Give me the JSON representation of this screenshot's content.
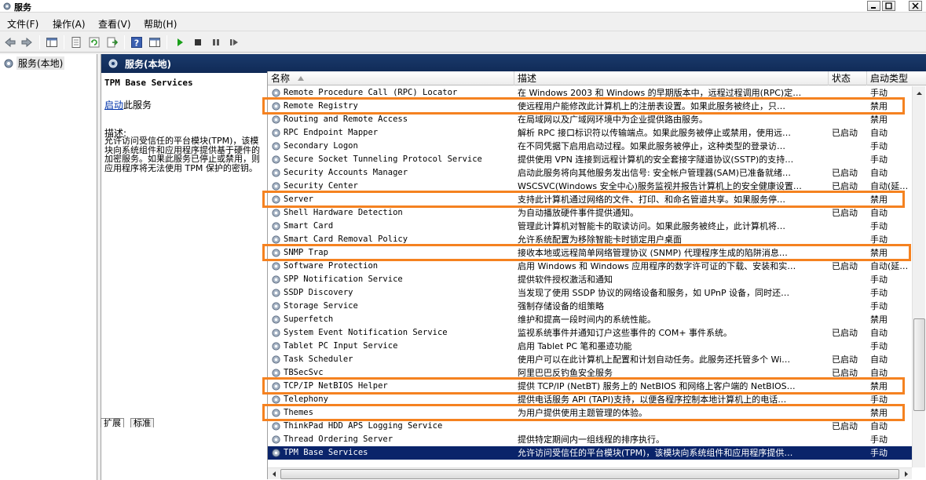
{
  "window": {
    "title": "服务"
  },
  "menu": [
    "文件(F)",
    "操作(A)",
    "查看(V)",
    "帮助(H)"
  ],
  "toolbar": {
    "icons": [
      "back-icon",
      "forward-icon",
      "console-tree-icon",
      "properties-icon",
      "refresh-icon",
      "export-icon",
      "help-icon",
      "show-hide-icon",
      "start-icon",
      "stop-icon",
      "pause-icon",
      "restart-icon"
    ]
  },
  "tree": {
    "root_label": "服务(本地)"
  },
  "content": {
    "header_title": "服务(本地)"
  },
  "detail": {
    "service_name": "TPM Base Services",
    "start_link": "启动",
    "start_suffix": "此服务",
    "desc_label": "描述:",
    "desc_text": "允许访问受信任的平台模块(TPM)，该模块向系统组件和应用程序提供基于硬件的加密服务。如果此服务已停止或禁用，则应用程序将无法使用 TPM 保护的密钥。"
  },
  "columns": {
    "name": "名称",
    "desc": "描述",
    "status": "状态",
    "startup": "启动类型"
  },
  "services": [
    {
      "name": "Remote Procedure Call (RPC) Locator",
      "desc": "在 Windows 2003 和 Windows 的早期版本中，远程过程调用(RPC)定…",
      "status": "",
      "startup": "手动"
    },
    {
      "name": "Remote Registry",
      "desc": "使远程用户能修改此计算机上的注册表设置。如果此服务被终止，只…",
      "status": "",
      "startup": "禁用"
    },
    {
      "name": "Routing and Remote Access",
      "desc": "在局域网以及广域网环境中为企业提供路由服务。",
      "status": "",
      "startup": "禁用"
    },
    {
      "name": "RPC Endpoint Mapper",
      "desc": "解析 RPC 接口标识符以传输端点。如果此服务被停止或禁用，使用远…",
      "status": "已启动",
      "startup": "自动"
    },
    {
      "name": "Secondary Logon",
      "desc": "在不同凭据下启用启动过程。如果此服务被停止，这种类型的登录访…",
      "status": "",
      "startup": "手动"
    },
    {
      "name": "Secure Socket Tunneling Protocol Service",
      "desc": "提供使用 VPN 连接到远程计算机的安全套接字隧道协议(SSTP)的支持…",
      "status": "",
      "startup": "手动"
    },
    {
      "name": "Security Accounts Manager",
      "desc": "启动此服务将向其他服务发出信号: 安全帐户管理器(SAM)已准备就绪…",
      "status": "已启动",
      "startup": "自动"
    },
    {
      "name": "Security Center",
      "desc": "WSCSVC(Windows 安全中心)服务监视并报告计算机上的安全健康设置…",
      "status": "已启动",
      "startup": "自动(延…"
    },
    {
      "name": "Server",
      "desc": "支持此计算机通过网络的文件、打印、和命名管道共享。如果服务停…",
      "status": "",
      "startup": "禁用"
    },
    {
      "name": "Shell Hardware Detection",
      "desc": "为自动播放硬件事件提供通知。",
      "status": "已启动",
      "startup": "自动"
    },
    {
      "name": "Smart Card",
      "desc": "管理此计算机对智能卡的取读访问。如果此服务被终止，此计算机将…",
      "status": "",
      "startup": "手动"
    },
    {
      "name": "Smart Card Removal Policy",
      "desc": "允许系统配置为移除智能卡时锁定用户桌面",
      "status": "",
      "startup": "手动"
    },
    {
      "name": "SNMP Trap",
      "desc": "接收本地或远程简单网络管理协议 (SNMP) 代理程序生成的陷阱消息…",
      "status": "",
      "startup": "禁用"
    },
    {
      "name": "Software Protection",
      "desc": "启用 Windows 和 Windows 应用程序的数字许可证的下载、安装和实…",
      "status": "已启动",
      "startup": "自动(延…"
    },
    {
      "name": "SPP Notification Service",
      "desc": "提供软件授权激活和通知",
      "status": "",
      "startup": "手动"
    },
    {
      "name": "SSDP Discovery",
      "desc": "当发现了使用 SSDP 协议的网络设备和服务，如 UPnP 设备，同时还…",
      "status": "",
      "startup": "手动"
    },
    {
      "name": "Storage Service",
      "desc": "强制存储设备的组策略",
      "status": "",
      "startup": "手动"
    },
    {
      "name": "Superfetch",
      "desc": "维护和提高一段时间内的系统性能。",
      "status": "",
      "startup": "禁用"
    },
    {
      "name": "System Event Notification Service",
      "desc": "监视系统事件并通知订户这些事件的 COM+ 事件系统。",
      "status": "已启动",
      "startup": "自动"
    },
    {
      "name": "Tablet PC Input Service",
      "desc": "启用 Tablet PC 笔和墨迹功能",
      "status": "",
      "startup": "手动"
    },
    {
      "name": "Task Scheduler",
      "desc": "使用户可以在此计算机上配置和计划自动任务。此服务还托管多个 Wi…",
      "status": "已启动",
      "startup": "自动"
    },
    {
      "name": "TBSecSvc",
      "desc": "阿里巴巴反钓鱼安全服务",
      "status": "已启动",
      "startup": "自动"
    },
    {
      "name": "TCP/IP NetBIOS Helper",
      "desc": "提供 TCP/IP (NetBT) 服务上的 NetBIOS 和网络上客户端的 NetBIOS…",
      "status": "",
      "startup": "禁用"
    },
    {
      "name": "Telephony",
      "desc": "提供电话服务 API (TAPI)支持，以便各程序控制本地计算机上的电话…",
      "status": "",
      "startup": "手动"
    },
    {
      "name": "Themes",
      "desc": "为用户提供使用主题管理的体验。",
      "status": "",
      "startup": "禁用"
    },
    {
      "name": "ThinkPad HDD APS Logging Service",
      "desc": "",
      "status": "已启动",
      "startup": "自动"
    },
    {
      "name": "Thread Ordering Server",
      "desc": "提供特定期间内一组线程的排序执行。",
      "status": "",
      "startup": "手动"
    },
    {
      "name": "TPM Base Services",
      "desc": "允许访问受信任的平台模块(TPM)，该模块向系统组件和应用程序提供…",
      "status": "",
      "startup": "手动"
    }
  ],
  "selected_index": 27,
  "highlighted_indices": [
    1,
    8,
    12,
    22,
    24
  ],
  "tabs": [
    "扩展",
    "标准"
  ],
  "colors": {
    "highlight": "#f58220",
    "selection": "#0a246a",
    "header": "#1a3a6c"
  }
}
